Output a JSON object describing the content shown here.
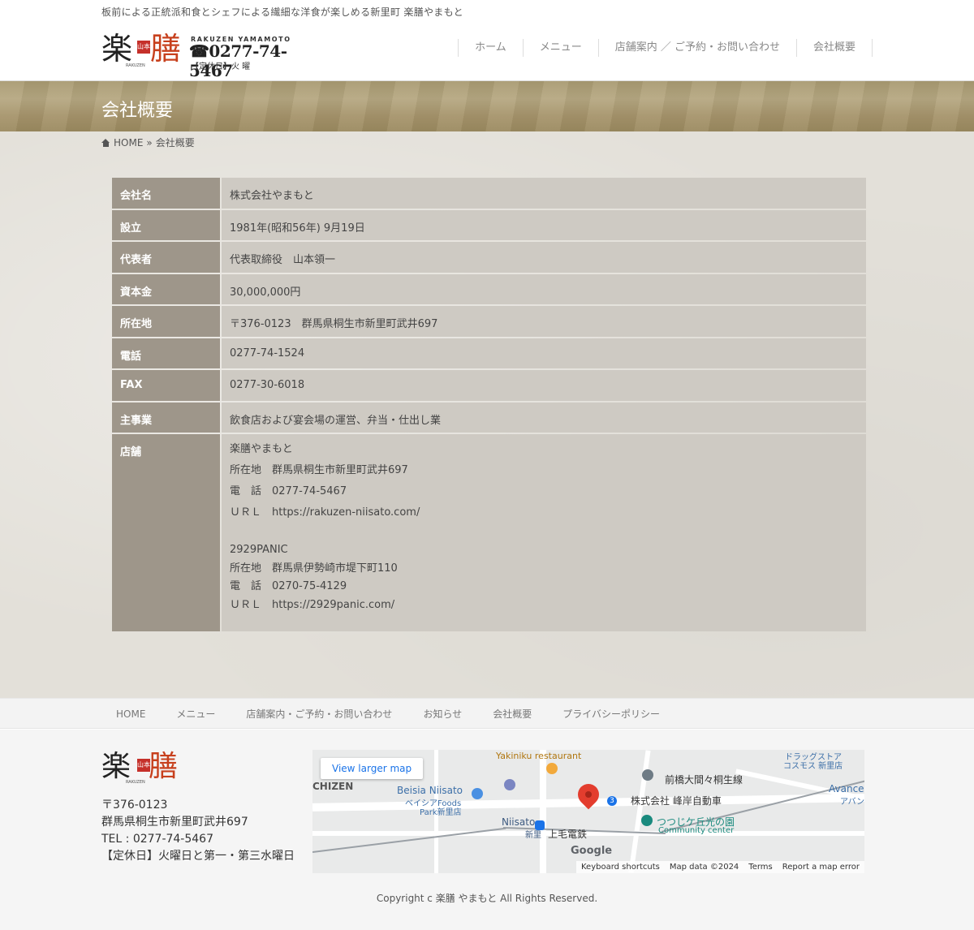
{
  "header": {
    "tagline": "板前による正統派和食とシェフによる繊細な洋食が楽しめる新里町 楽膳やまもと",
    "logo_kanji_1": "楽",
    "logo_kanji_2": "膳",
    "logo_seal": "山本",
    "logo_romaji": "RAKUZEN",
    "brand_en": "RAKUZEN YAMAMOTO",
    "tel": "☎0277-74-5467",
    "closed": "【定休日】火 曜"
  },
  "nav": {
    "items": [
      "ホーム",
      "メニュー",
      "店舗案内 ／ ご予約・お問い合わせ",
      "会社概要"
    ]
  },
  "page_title": "会社概要",
  "breadcrumb": {
    "home": "HOME",
    "separator": "»",
    "current": "会社概要"
  },
  "company": {
    "rows": [
      {
        "label": "会社名",
        "value": "株式会社やまもと"
      },
      {
        "label": "設立",
        "value": "1981年(昭和56年) 9月19日"
      },
      {
        "label": "代表者",
        "value": "代表取締役　山本領一"
      },
      {
        "label": "資本金",
        "value": "30,000,000円"
      },
      {
        "label": "所在地",
        "value": "〒376-0123　群馬県桐生市新里町武井697"
      },
      {
        "label": "電話",
        "value": "0277-74-1524"
      },
      {
        "label": "FAX",
        "value": "0277-30-6018"
      },
      {
        "label": "主事業",
        "value": "飲食店および宴会場の運営、弁当・仕出し業"
      }
    ],
    "store_label": "店舗",
    "store1": {
      "name": "楽膳やまもと",
      "address": "所在地　群馬県桐生市新里町武井697",
      "tel": "電　話　0277-74-5467",
      "url": "ＵＲＬ　https://rakuzen-niisato.com/"
    },
    "store2": {
      "name": "2929PANIC",
      "address": "所在地　群馬県伊勢崎市堤下町110",
      "tel": "電　話　0270-75-4129",
      "url": "ＵＲＬ　https://2929panic.com/"
    }
  },
  "footer_nav": {
    "items": [
      "HOME",
      "メニュー",
      "店舗案内・ご予約・お問い合わせ",
      "お知らせ",
      "会社概要",
      "プライバシーポリシー"
    ]
  },
  "footer": {
    "postal": "〒376-0123",
    "address": "群馬県桐生市新里町武井697",
    "tel": "TEL : 0277-74-5467",
    "closed": "【定休日】火曜日と第一・第三水曜日",
    "copyright": "Copyright c 楽膳 やまもと All Rights Reserved."
  },
  "map": {
    "view_larger": "View larger map",
    "labels": {
      "yakiniku": "Yakiniku restaurant",
      "chizen": "CHIZEN",
      "beisia_en": "Beisia Niisato",
      "beisia_jp": "ベイシアFoods",
      "beisia_jp2": "Park新里店",
      "niisato_en": "Niisato",
      "niisato_jp": "新里",
      "joumou": "上毛電鉄",
      "route": "前橋大間々桐生線",
      "company": "株式会社 峰岸自動車",
      "park_jp": "つつじケ丘光の園",
      "park_en": "Community center",
      "drugstore1": "ドラッグストア",
      "drugstore2": "コスモス 新里店",
      "avance": "Avance",
      "avance2": "アバン",
      "route_no": "3",
      "google": "Google"
    },
    "attribution": [
      "Keyboard shortcuts",
      "Map data ©2024",
      "Terms",
      "Report a map error"
    ]
  }
}
